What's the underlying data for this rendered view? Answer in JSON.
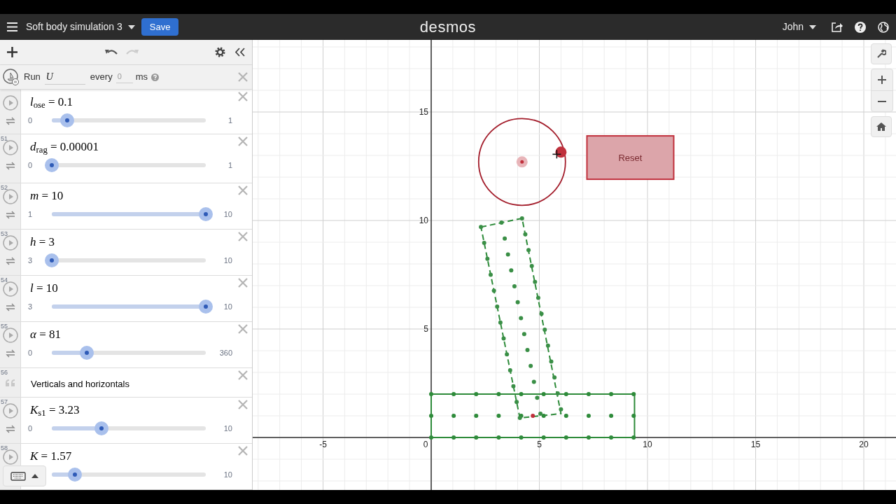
{
  "header": {
    "title": "Soft body simulation 3",
    "save": "Save",
    "logo": "desmos",
    "user": "John"
  },
  "ticker": {
    "run": "Run",
    "handler": "U",
    "every": "every",
    "interval": "0",
    "unit": "ms"
  },
  "expressions": [
    {
      "kind": "slider",
      "latex": "*l*$_{ose}$ = 0.1",
      "min": "0",
      "max": "1",
      "level": 0.1
    },
    {
      "kind": "slider",
      "number": "51",
      "latex": "*d*$_{rag}$ = 0.00001",
      "min": "0",
      "max": "1",
      "level": 0
    },
    {
      "kind": "slider",
      "number": "52",
      "latex": "*m* = 10",
      "min": "1",
      "max": "10",
      "level": 1
    },
    {
      "kind": "slider",
      "number": "53",
      "latex": "*h* = 3",
      "min": "3",
      "max": "10",
      "level": 0
    },
    {
      "kind": "slider",
      "number": "54",
      "latex": "*l* = 10",
      "min": "3",
      "max": "10",
      "level": 1
    },
    {
      "kind": "slider",
      "number": "55",
      "latex": "*α* = 81",
      "min": "0",
      "max": "360",
      "level": 0.225
    },
    {
      "kind": "note",
      "number": "56",
      "text": "Verticals and horizontals"
    },
    {
      "kind": "slider",
      "number": "57",
      "latex": "*K*$_{s1}$ = 3.23",
      "min": "0",
      "max": "10",
      "level": 0.323
    },
    {
      "kind": "slider",
      "number": "58",
      "latex": "*K* = 1.57",
      "max": "10",
      "level": 0.152
    }
  ],
  "graph": {
    "x_ticks": [
      "-5",
      "0",
      "5",
      "10",
      "15",
      "20"
    ],
    "y_ticks": [
      "15",
      "10",
      "5"
    ],
    "button": "Reset"
  }
}
